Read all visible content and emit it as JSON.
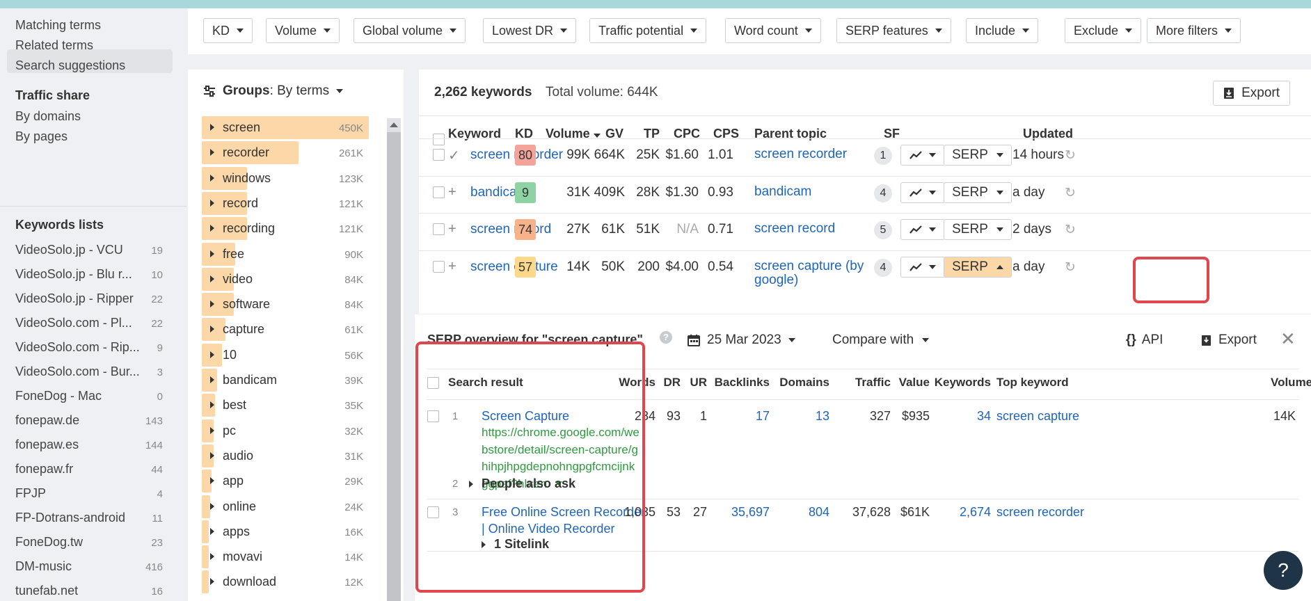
{
  "sidebar": {
    "top_items": [
      "Matching terms",
      "Related terms",
      "Search suggestions"
    ],
    "traffic_share_heading": "Traffic share",
    "traffic_share_items": [
      "By domains",
      "By pages"
    ],
    "keywords_lists_heading": "Keywords lists",
    "keywords_lists": [
      {
        "name": "VideoSolo.jp - VCU",
        "count": "19"
      },
      {
        "name": "VideoSolo.jp - Blu r...",
        "count": "10"
      },
      {
        "name": "VideoSolo.jp - Ripper",
        "count": "22"
      },
      {
        "name": "VideoSolo.com - Pl...",
        "count": "22"
      },
      {
        "name": "VideoSolo.com - Rip...",
        "count": "9"
      },
      {
        "name": "VideoSolo.com - Bur...",
        "count": "3"
      },
      {
        "name": "FoneDog - Mac",
        "count": "0"
      },
      {
        "name": "fonepaw.de",
        "count": "143"
      },
      {
        "name": "fonepaw.es",
        "count": "144"
      },
      {
        "name": "fonepaw.fr",
        "count": "44"
      },
      {
        "name": "FPJP",
        "count": "4"
      },
      {
        "name": "FP-Dotrans-android",
        "count": "11"
      },
      {
        "name": "FoneDog.tw",
        "count": "23"
      },
      {
        "name": "DM-music",
        "count": "416"
      },
      {
        "name": "tunefab.net",
        "count": "16"
      }
    ]
  },
  "filters": [
    "KD",
    "Volume",
    "Global volume",
    "Lowest DR",
    "Traffic potential",
    "Word count",
    "SERP features",
    "Include",
    "Exclude",
    "More filters"
  ],
  "groups": {
    "label": "Groups",
    "mode": "By terms",
    "items": [
      {
        "term": "screen",
        "value": "450K",
        "fill": 1.0
      },
      {
        "term": "recorder",
        "value": "261K",
        "fill": 0.58
      },
      {
        "term": "windows",
        "value": "123K",
        "fill": 0.27
      },
      {
        "term": "record",
        "value": "121K",
        "fill": 0.27
      },
      {
        "term": "recording",
        "value": "121K",
        "fill": 0.27
      },
      {
        "term": "free",
        "value": "90K",
        "fill": 0.2
      },
      {
        "term": "video",
        "value": "84K",
        "fill": 0.19
      },
      {
        "term": "software",
        "value": "84K",
        "fill": 0.19
      },
      {
        "term": "capture",
        "value": "61K",
        "fill": 0.14
      },
      {
        "term": "10",
        "value": "56K",
        "fill": 0.12
      },
      {
        "term": "bandicam",
        "value": "39K",
        "fill": 0.09
      },
      {
        "term": "best",
        "value": "35K",
        "fill": 0.08
      },
      {
        "term": "pc",
        "value": "32K",
        "fill": 0.07
      },
      {
        "term": "audio",
        "value": "31K",
        "fill": 0.07
      },
      {
        "term": "app",
        "value": "29K",
        "fill": 0.06
      },
      {
        "term": "online",
        "value": "24K",
        "fill": 0.05
      },
      {
        "term": "apps",
        "value": "16K",
        "fill": 0.04
      },
      {
        "term": "movavi",
        "value": "14K",
        "fill": 0.03
      },
      {
        "term": "download",
        "value": "12K",
        "fill": 0.03
      }
    ]
  },
  "keywords": {
    "count_label": "2,262 keywords",
    "total_label": "Total volume: 644K",
    "export_label": "Export",
    "columns": [
      "Keyword",
      "KD",
      "Volume",
      "GV",
      "TP",
      "CPC",
      "CPS",
      "Parent topic",
      "SF",
      "Updated"
    ],
    "rows": [
      {
        "keyword": "screen recorder",
        "kd": "80",
        "kd_color": "#f4a39a",
        "volume": "99K",
        "gv": "664K",
        "tp": "25K",
        "cpc": "$1.60",
        "cps": "1.01",
        "parent": "screen recorder",
        "sf": "1",
        "serp": "SERP",
        "updated": "14 hours",
        "added": true
      },
      {
        "keyword": "bandicam",
        "kd": "9",
        "kd_color": "#8fd3a4",
        "volume": "31K",
        "gv": "409K",
        "tp": "28K",
        "cpc": "$1.30",
        "cps": "0.93",
        "parent": "bandicam",
        "sf": "4",
        "serp": "SERP",
        "updated": "a day",
        "added": false
      },
      {
        "keyword": "screen record",
        "kd": "74",
        "kd_color": "#f7b28a",
        "volume": "27K",
        "gv": "61K",
        "tp": "51K",
        "cpc": "N/A",
        "cps": "0.71",
        "parent": "screen record",
        "sf": "5",
        "serp": "SERP",
        "updated": "2 days",
        "added": false
      },
      {
        "keyword": "screen capture",
        "kd": "57",
        "kd_color": "#fcd98a",
        "volume": "14K",
        "gv": "50K",
        "tp": "200",
        "cpc": "$4.00",
        "cps": "0.54",
        "parent": "screen capture (by google)",
        "sf": "4",
        "serp": "SERP",
        "updated": "a day",
        "added": false
      }
    ]
  },
  "serp": {
    "title": "SERP overview for \"screen capture\"",
    "date": "25 Mar 2023",
    "compare_label": "Compare with",
    "api_label": "API",
    "export_label": "Export",
    "columns": [
      "Search result",
      "Words",
      "DR",
      "UR",
      "Backlinks",
      "Domains",
      "Traffic",
      "Value",
      "Keywords",
      "Top keyword",
      "Volume"
    ],
    "rows": [
      {
        "pos": "1",
        "title": "Screen Capture",
        "url_lines": [
          "https://chrome.google.com/we",
          "bstore/detail/screen-capture/g",
          "hihpjhpgdepnohngpgfcmcijnk",
          "ggpaf?hl=en"
        ],
        "sitelink": "1 Sitelink",
        "words": "284",
        "dr": "93",
        "ur": "1",
        "backlinks": "17",
        "domains": "13",
        "traffic": "327",
        "value": "$935",
        "keywords": "34",
        "top_keyword": "screen capture",
        "volume": "14K"
      },
      {
        "pos": "2",
        "paa": "People also ask"
      },
      {
        "pos": "3",
        "title_lines": [
          "Free Online Screen Recorder",
          "| Online Video Recorder"
        ],
        "words": "1,035",
        "dr": "53",
        "ur": "27",
        "backlinks": "35,697",
        "domains": "804",
        "traffic": "37,628",
        "value": "$61K",
        "keywords": "2,674",
        "top_keyword": "screen recorder",
        "volume": ""
      }
    ]
  },
  "help_label": "?"
}
